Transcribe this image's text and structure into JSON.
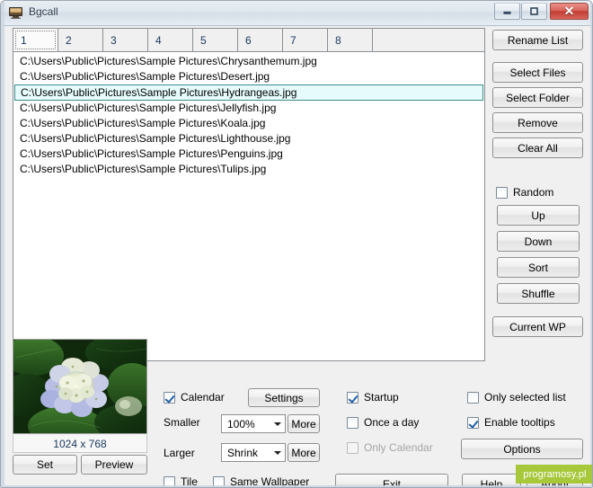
{
  "window": {
    "title": "Bgcall",
    "icon": "monitor-icon",
    "controls": {
      "minimize": "–",
      "maximize": "□",
      "close": "✕"
    }
  },
  "tabs": {
    "items": [
      {
        "label": "1",
        "selected": true
      },
      {
        "label": "2",
        "selected": false
      },
      {
        "label": "3",
        "selected": false
      },
      {
        "label": "4",
        "selected": false
      },
      {
        "label": "5",
        "selected": false
      },
      {
        "label": "6",
        "selected": false
      },
      {
        "label": "7",
        "selected": false
      },
      {
        "label": "8",
        "selected": false
      }
    ]
  },
  "file_list": {
    "items": [
      {
        "path": "C:\\Users\\Public\\Pictures\\Sample Pictures\\Chrysanthemum.jpg",
        "selected": false
      },
      {
        "path": "C:\\Users\\Public\\Pictures\\Sample Pictures\\Desert.jpg",
        "selected": false
      },
      {
        "path": "C:\\Users\\Public\\Pictures\\Sample Pictures\\Hydrangeas.jpg",
        "selected": true
      },
      {
        "path": "C:\\Users\\Public\\Pictures\\Sample Pictures\\Jellyfish.jpg",
        "selected": false
      },
      {
        "path": "C:\\Users\\Public\\Pictures\\Sample Pictures\\Koala.jpg",
        "selected": false
      },
      {
        "path": "C:\\Users\\Public\\Pictures\\Sample Pictures\\Lighthouse.jpg",
        "selected": false
      },
      {
        "path": "C:\\Users\\Public\\Pictures\\Sample Pictures\\Penguins.jpg",
        "selected": false
      },
      {
        "path": "C:\\Users\\Public\\Pictures\\Sample Pictures\\Tulips.jpg",
        "selected": false
      }
    ],
    "selection_bg": "#e6fbfb",
    "selection_border": "#3d8c8c"
  },
  "list_actions": {
    "rename": "Rename List",
    "select_files": "Select Files",
    "select_folder": "Select Folder",
    "remove": "Remove",
    "clear_all": "Clear All"
  },
  "order_actions": {
    "random_label": "Random",
    "random_checked": false,
    "up": "Up",
    "down": "Down",
    "sort": "Sort",
    "shuffle": "Shuffle",
    "current_wp": "Current WP"
  },
  "preview": {
    "dimensions": "1024 x 768",
    "set": "Set",
    "preview": "Preview",
    "image_alt": "hydrangea-flower-photo"
  },
  "display_options": {
    "calendar_label": "Calendar",
    "calendar_checked": true,
    "settings": "Settings",
    "smaller_label": "Smaller",
    "scale_value": "100%",
    "more_1": "More",
    "larger_label": "Larger",
    "fit_value": "Shrink",
    "more_2": "More",
    "tile_label": "Tile",
    "tile_checked": false,
    "same_wallpaper_label": "Same Wallpaper",
    "same_wallpaper_checked": false
  },
  "behavior_options": {
    "startup_label": "Startup",
    "startup_checked": true,
    "once_a_day_label": "Once a day",
    "once_a_day_checked": false,
    "only_calendar_label": "Only Calendar",
    "only_calendar_checked": false,
    "only_calendar_disabled": true,
    "only_selected_list_label": "Only selected list",
    "only_selected_list_checked": false,
    "enable_tooltips_label": "Enable tooltips",
    "enable_tooltips_checked": true,
    "options": "Options"
  },
  "footer": {
    "exit": "Exit",
    "help": "Help",
    "about": "About"
  },
  "watermark": {
    "text": "programosy.pl",
    "color": "#a8c83c"
  }
}
